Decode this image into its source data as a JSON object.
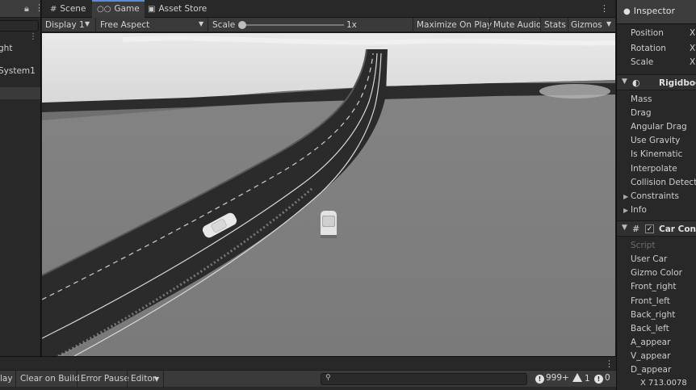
{
  "hierarchy": {
    "items": [
      {
        "label": "ght"
      },
      {
        "label": "System1"
      }
    ]
  },
  "tabs": [
    {
      "label": "Scene",
      "icon": "hash-icon"
    },
    {
      "label": "Game",
      "icon": "gamepad-icon",
      "active": true
    },
    {
      "label": "Asset Store",
      "icon": "bag-icon"
    }
  ],
  "game_toolbar": {
    "display": "Display 1",
    "aspect": "Free Aspect",
    "scale_label": "Scale",
    "scale_value": "1x",
    "maximize": "Maximize On Play",
    "mute": "Mute Audio",
    "stats": "Stats",
    "gizmos": "Gizmos"
  },
  "inspector": {
    "title": "Inspector",
    "transform_rows": [
      "Position",
      "Rotation",
      "Scale"
    ],
    "axis_label": "X",
    "rigidbody": {
      "name": "Rigidbody",
      "rows": [
        "Mass",
        "Drag",
        "Angular Drag",
        "Use Gravity",
        "Is Kinematic",
        "Interpolate",
        "Collision Detection"
      ],
      "foldouts": [
        "Constraints",
        "Info"
      ]
    },
    "script_component": {
      "name": "Car Contr",
      "script_label": "Script",
      "rows": [
        "User Car",
        "Gizmo Color",
        "Front_right",
        "Front_left",
        "Back_right",
        "Back_left",
        "A_appear",
        "V_appear",
        "D_appear"
      ]
    },
    "coord_readout": "X 713.0078"
  },
  "console": {
    "buttons": [
      "lay",
      "Clear on Build",
      "Error Pause",
      "Editor"
    ],
    "search_placeholder": "",
    "log_count": "999+",
    "warn_count": "1",
    "error_count": "0"
  },
  "colors": {
    "accent": "#5b8bd8",
    "ground": "#7c7c7c",
    "road": "#2b2b2b"
  }
}
